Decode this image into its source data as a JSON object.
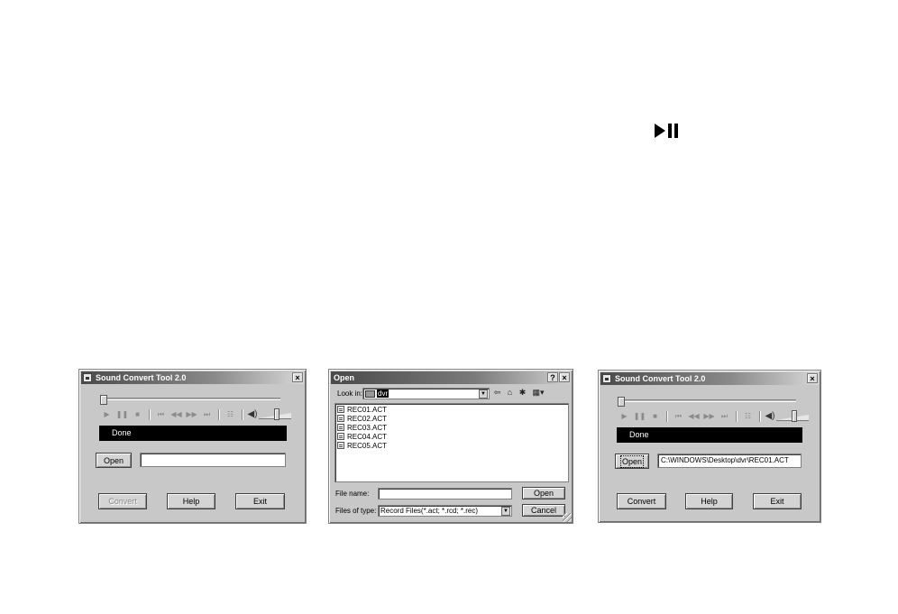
{
  "window1": {
    "title": "Sound Convert Tool 2.0",
    "close": "×",
    "status": "Done",
    "path_value": "",
    "buttons": {
      "open": "Open",
      "convert": "Convert",
      "help": "Help",
      "exit": "Exit"
    },
    "convert_enabled": false
  },
  "open_dialog": {
    "title": "Open",
    "help_btn": "?",
    "close": "×",
    "look_in_label": "Look in:",
    "look_in_value": "dvr",
    "files": [
      "REC01.ACT",
      "REC02.ACT",
      "REC03.ACT",
      "REC04.ACT",
      "REC05.ACT"
    ],
    "file_name_label": "File name:",
    "file_name_value": "",
    "files_of_type_label": "Files of type:",
    "files_of_type_value": "Record Files(*.act; *.rcd; *.rec)",
    "buttons": {
      "open": "Open",
      "cancel": "Cancel"
    }
  },
  "window2": {
    "title": "Sound Convert Tool 2.0",
    "close": "×",
    "status": "Done",
    "path_value": "C:\\WINDOWS\\Desktop\\dvr\\REC01.ACT",
    "buttons": {
      "open": "Open",
      "convert": "Convert",
      "help": "Help",
      "exit": "Exit"
    },
    "convert_enabled": true
  },
  "icons": {
    "play_pause": "play-pause-icon",
    "controls": [
      "play-icon",
      "pause-icon",
      "stop-icon",
      "skip-back-icon",
      "rewind-icon",
      "fast-forward-icon",
      "skip-forward-icon",
      "playlist-icon",
      "speaker-icon"
    ]
  },
  "colors": {
    "window_bg": "#c8c8c8",
    "status_bg": "#000000",
    "status_fg": "#ffffff"
  }
}
